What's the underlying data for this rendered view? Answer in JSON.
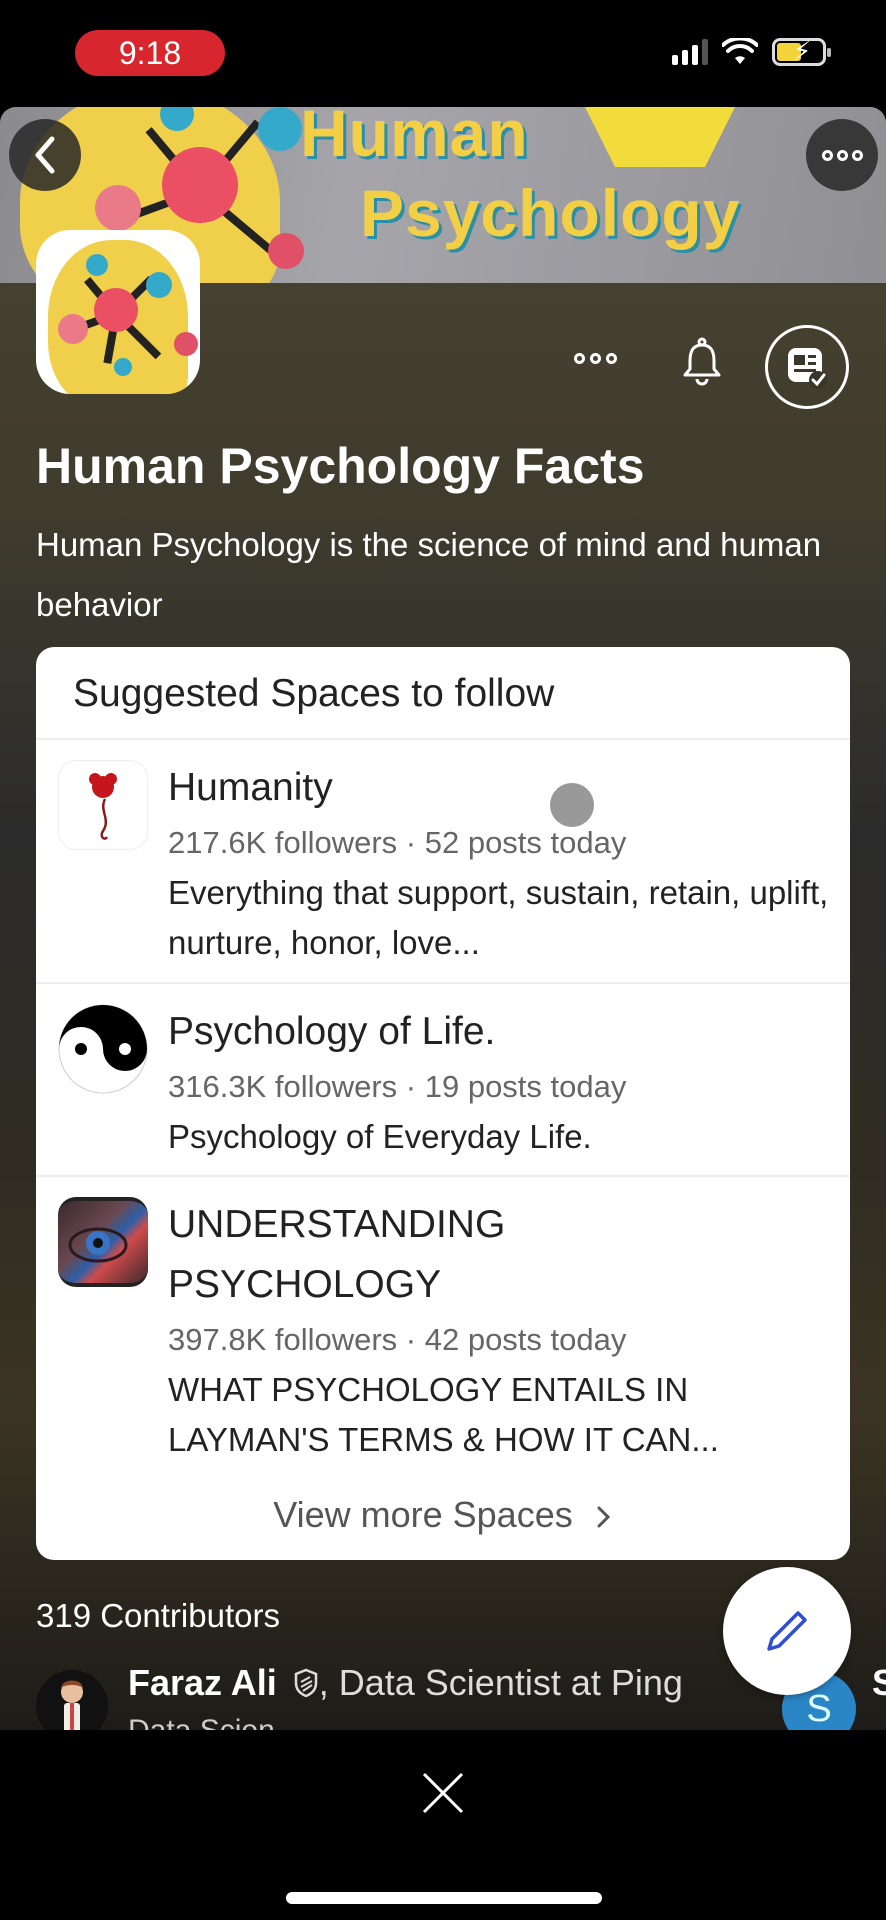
{
  "status_bar": {
    "time": "9:18",
    "icons": [
      "cellular-signal-icon",
      "wifi-icon",
      "battery-charging-icon"
    ]
  },
  "banner": {
    "line1": "Human",
    "line2": "Psychology",
    "back_icon": "chevron-left-icon",
    "more_icon": "more-horizontal-icon"
  },
  "space": {
    "title": "Human Psychology Facts",
    "description": "Human Psychology is the science of mind and human behavior",
    "actions": {
      "more_icon": "more-horizontal-icon",
      "notify_icon": "bell-icon",
      "follow_icon": "followed-space-icon"
    }
  },
  "suggested": {
    "header": "Suggested Spaces to follow",
    "items": [
      {
        "name": "Humanity",
        "meta": "217.6K followers · 52 posts today",
        "about": "Everything that support, sustain, retain, uplift, nurture, honor, love..."
      },
      {
        "name": "Psychology of Life.",
        "meta": "316.3K followers · 19 posts today",
        "about": "Psychology of Everyday Life."
      },
      {
        "name": "UNDERSTANDING PSYCHOLOGY",
        "meta": "397.8K followers · 42 posts today",
        "about": "WHAT PSYCHOLOGY ENTAILS IN LAYMAN'S TERMS & HOW IT CAN..."
      }
    ],
    "view_more": "View more Spaces",
    "view_more_icon": "chevron-right-icon"
  },
  "contributors": {
    "title": "319 Contributors",
    "items": [
      {
        "name": "Faraz Ali",
        "badge_icon": "shield-badge-icon",
        "credential": ", Data Scientist at Ping",
        "credential_cont": "Data Scien..."
      },
      {
        "initial": "S",
        "name_partial": "S",
        "avatar_color": "#2a86c7"
      }
    ]
  },
  "fab": {
    "icon": "pencil-icon",
    "color": "#2f4fd0"
  },
  "bottom": {
    "close_icon": "close-icon"
  },
  "colors": {
    "time_pill": "#d7262e",
    "card_bg": "#ffffff",
    "accent_blue": "#2f4fd0"
  }
}
